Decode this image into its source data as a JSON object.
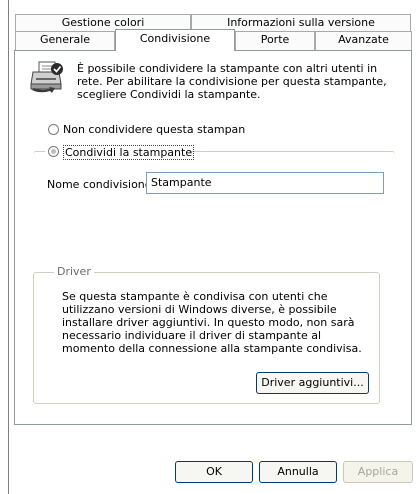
{
  "tabs": {
    "row1": [
      "Gestione colori",
      "Informazioni sulla versione"
    ],
    "row2": [
      "Generale",
      "Condivisione",
      "Porte",
      "Avanzate"
    ]
  },
  "sharing": {
    "info_text": "È possibile condividere la stampante con altri utenti in rete. Per abilitare la condivisione per questa stampante, scegliere Condividi la stampante.",
    "radio_no_share": "Non condividere questa stampan",
    "radio_share": "Condividi la stampante",
    "share_name_label": "Nome condivisione:",
    "share_name_value": "Stampante"
  },
  "driver": {
    "legend": "Driver",
    "text": "Se questa stampante è condivisa con utenti che utilizzano versioni di Windows diverse, è possibile installare driver aggiuntivi. In questo modo, non sarà necessario individuare il driver di stampante al momento della connessione alla stampante condivisa.",
    "button": "Driver aggiuntivi..."
  },
  "buttons": {
    "ok": "OK",
    "cancel": "Annulla",
    "apply": "Applica"
  }
}
